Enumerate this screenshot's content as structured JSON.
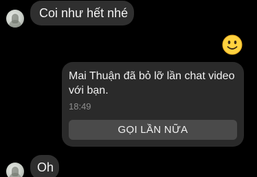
{
  "colors": {
    "background": "#000000",
    "bubble_incoming": "#2f2f2f",
    "call_card": "#2a2a2a",
    "call_button": "#4a4a4a",
    "text_primary": "#f2f2f2",
    "text_secondary": "#8e8e8e",
    "emoji_face": "#ffd23f"
  },
  "messages": [
    {
      "sender": "contact",
      "text": "Coi như hết nhé",
      "avatar_icon": "contact-avatar"
    },
    {
      "sender": "me",
      "emoji": "slightly-smiling-face-icon"
    },
    {
      "type": "missed-video-call",
      "text": "Mai Thuận đã bỏ lỡ lần chat video với bạn.",
      "time": "18:49",
      "button_label": "GỌI LẦN NỮA"
    },
    {
      "sender": "contact",
      "text": "Oh",
      "avatar_icon": "contact-avatar"
    }
  ]
}
